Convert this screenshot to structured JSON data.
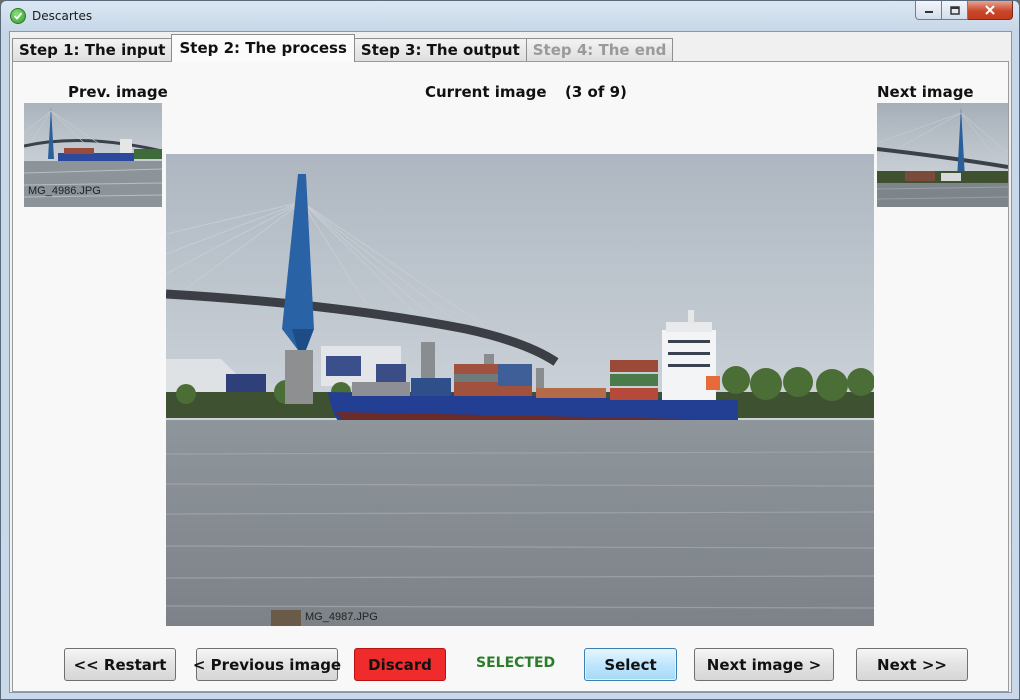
{
  "window": {
    "title": "Descartes"
  },
  "tabs": [
    {
      "label": "Step 1: The input",
      "state": "normal"
    },
    {
      "label": "Step 2: The process",
      "state": "active"
    },
    {
      "label": "Step 3: The output",
      "state": "normal"
    },
    {
      "label": "Step 4: The end",
      "state": "disabled"
    }
  ],
  "viewer": {
    "prev_label": "Prev. image",
    "current_label": "Current image",
    "counter": "(3 of 9)",
    "next_label": "Next image",
    "prev_filename": "MG_4986.JPG",
    "current_filename": "MG_4987.JPG"
  },
  "buttons": {
    "restart": "<< Restart",
    "previous": "< Previous image",
    "discard": "Discard",
    "status": "SELECTED",
    "select": "Select",
    "next_image": "Next image >",
    "next": "Next >>"
  },
  "colors": {
    "discard": "#f02b2b",
    "selected_status": "#2a7d2a",
    "select_highlight": "#bee6fd"
  },
  "icons": {
    "app": "check-circle-icon",
    "minimize": "minimize-icon",
    "maximize": "maximize-icon",
    "close": "close-icon"
  }
}
